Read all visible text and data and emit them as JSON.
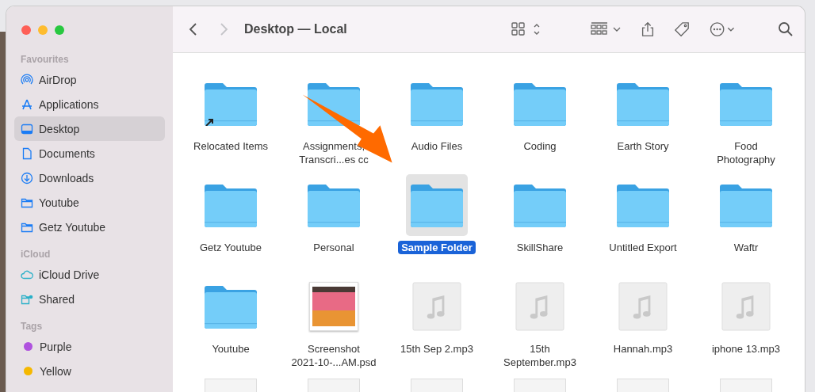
{
  "window": {
    "title": "Desktop — Local"
  },
  "toolbar": {
    "back_disabled": false,
    "forward_disabled": true
  },
  "sidebar": {
    "sections": [
      {
        "header": "Favourites",
        "items": [
          {
            "label": "AirDrop",
            "kind": "airdrop",
            "selected": false
          },
          {
            "label": "Applications",
            "kind": "applications",
            "selected": false
          },
          {
            "label": "Desktop",
            "kind": "desktop",
            "selected": true
          },
          {
            "label": "Documents",
            "kind": "document",
            "selected": false
          },
          {
            "label": "Downloads",
            "kind": "download",
            "selected": false
          },
          {
            "label": "Youtube",
            "kind": "folder",
            "selected": false
          },
          {
            "label": "Getz Youtube",
            "kind": "folder",
            "selected": false
          }
        ]
      },
      {
        "header": "iCloud",
        "items": [
          {
            "label": "iCloud Drive",
            "kind": "cloud",
            "selected": false
          },
          {
            "label": "Shared",
            "kind": "shared",
            "selected": false
          }
        ]
      },
      {
        "header": "Tags",
        "items": [
          {
            "label": "Purple",
            "kind": "tag",
            "color": "#af52de",
            "selected": false
          },
          {
            "label": "Yellow",
            "kind": "tag",
            "color": "#f5b800",
            "selected": false
          }
        ]
      }
    ]
  },
  "files": [
    {
      "label": "Relocated Items",
      "kind": "alias",
      "selected": false
    },
    {
      "label": "Assignments,\nTranscri...es cc",
      "kind": "folder",
      "selected": false
    },
    {
      "label": "Audio Files",
      "kind": "folder",
      "selected": false
    },
    {
      "label": "Coding",
      "kind": "folder",
      "selected": false
    },
    {
      "label": "Earth Story",
      "kind": "folder",
      "selected": false
    },
    {
      "label": "Food\nPhotography",
      "kind": "folder",
      "selected": false
    },
    {
      "label": "Getz Youtube",
      "kind": "folder",
      "selected": false
    },
    {
      "label": "Personal",
      "kind": "folder",
      "selected": false
    },
    {
      "label": "Sample Folder",
      "kind": "folder",
      "selected": true
    },
    {
      "label": "SkillShare",
      "kind": "folder",
      "selected": false
    },
    {
      "label": "Untitled Export",
      "kind": "folder",
      "selected": false
    },
    {
      "label": "Waftr",
      "kind": "folder",
      "selected": false
    },
    {
      "label": "Youtube",
      "kind": "folder",
      "selected": false
    },
    {
      "label": "Screenshot\n2021-10-...AM.psd",
      "kind": "image",
      "selected": false
    },
    {
      "label": "15th Sep 2.mp3",
      "kind": "audio",
      "selected": false
    },
    {
      "label": "15th\nSeptember.mp3",
      "kind": "audio",
      "selected": false
    },
    {
      "label": "Hannah.mp3",
      "kind": "audio",
      "selected": false
    },
    {
      "label": "iphone 13.mp3",
      "kind": "audio",
      "selected": false
    },
    {
      "kind": "document",
      "selected": false
    },
    {
      "kind": "document",
      "selected": false
    },
    {
      "kind": "document",
      "selected": false
    },
    {
      "kind": "document",
      "selected": false
    },
    {
      "kind": "document",
      "selected": false
    },
    {
      "kind": "document",
      "selected": false
    }
  ]
}
